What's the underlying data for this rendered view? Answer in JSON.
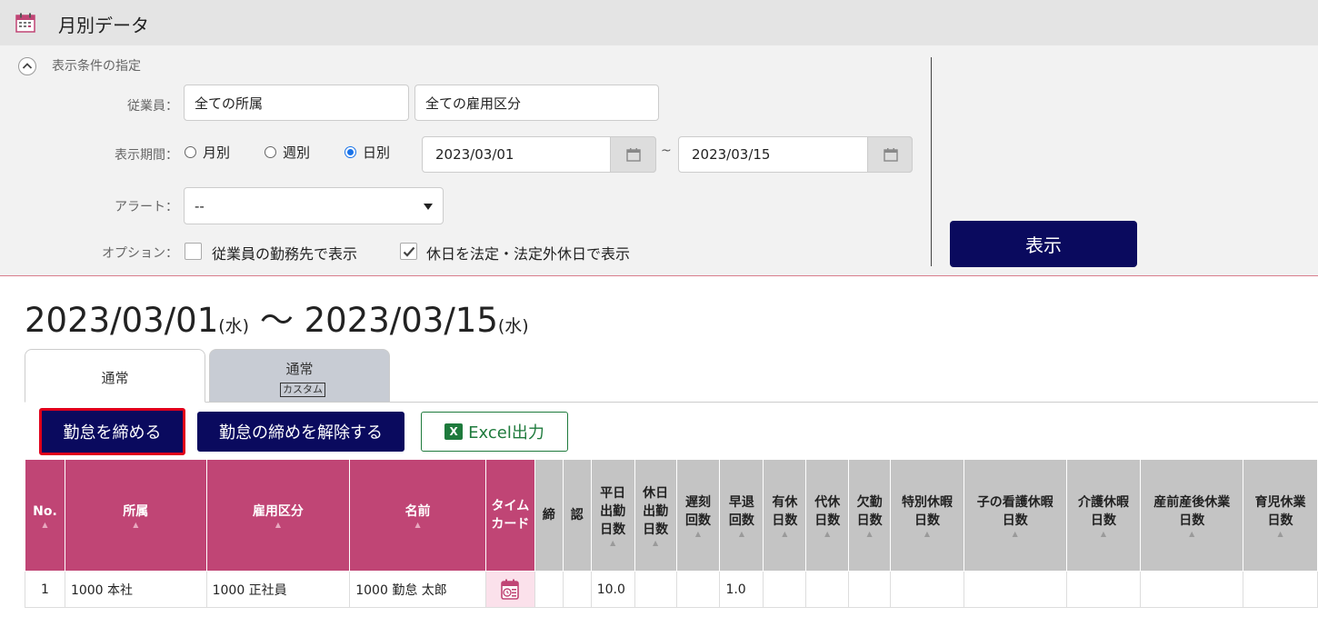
{
  "page": {
    "title": "月別データ"
  },
  "filter": {
    "section_label": "表示条件の指定",
    "employee_label": "従業員：",
    "department_value": "全ての所属",
    "employment_value": "全ての雇用区分",
    "period_label": "表示期間：",
    "radio_monthly": "月別",
    "radio_weekly": "週別",
    "radio_daily": "日別",
    "selected_period": "日別",
    "date_from": "2023/03/01",
    "tilde": "~",
    "date_to": "2023/03/15",
    "alert_label": "アラート：",
    "alert_value": "--",
    "option_label": "オプション：",
    "option1": "従業員の勤務先で表示",
    "option1_checked": false,
    "option2": "休日を法定・法定外休日で表示",
    "option2_checked": true,
    "show_button": "表示"
  },
  "range": {
    "from": "2023/03/01",
    "from_dow": "(水)",
    "sep": " 〜 ",
    "to": "2023/03/15",
    "to_dow": "(水)"
  },
  "tabs": [
    {
      "label": "通常",
      "sub": "",
      "active": true
    },
    {
      "label": "通常",
      "sub": "カスタム",
      "active": false
    }
  ],
  "actions": {
    "close": "勤怠を締める",
    "unclose": "勤怠の締めを解除する",
    "excel": "Excel出力",
    "excel_icon_letter": "X"
  },
  "table": {
    "headers": [
      "No.",
      "所属",
      "雇用区分",
      "名前",
      "タイム\nカード",
      "締",
      "認",
      "平日\n出勤\n日数",
      "休日\n出勤\n日数",
      "遅刻\n回数",
      "早退\n回数",
      "有休\n日数",
      "代休\n日数",
      "欠勤\n日数",
      "特別休暇\n日数",
      "子の看護休暇\n日数",
      "介護休暇\n日数",
      "産前産後休業\n日数",
      "育児休業\n日数"
    ],
    "rows": [
      {
        "no": "1",
        "dept": "1000 本社",
        "type": "1000 正社員",
        "name": "1000 勤怠 太郎",
        "shime": "",
        "nin": "",
        "weekday": "10.0",
        "holiday": "",
        "late": "",
        "early": "1.0",
        "paid": "",
        "comp": "",
        "absent": "",
        "special": "",
        "nursing": "",
        "care": "",
        "maternity": "",
        "childcare": ""
      }
    ]
  },
  "colors": {
    "accent_pink": "#c04575",
    "navy": "#0a0a5e",
    "highlight_red": "#e0001b",
    "excel_green": "#1e7a3c"
  }
}
